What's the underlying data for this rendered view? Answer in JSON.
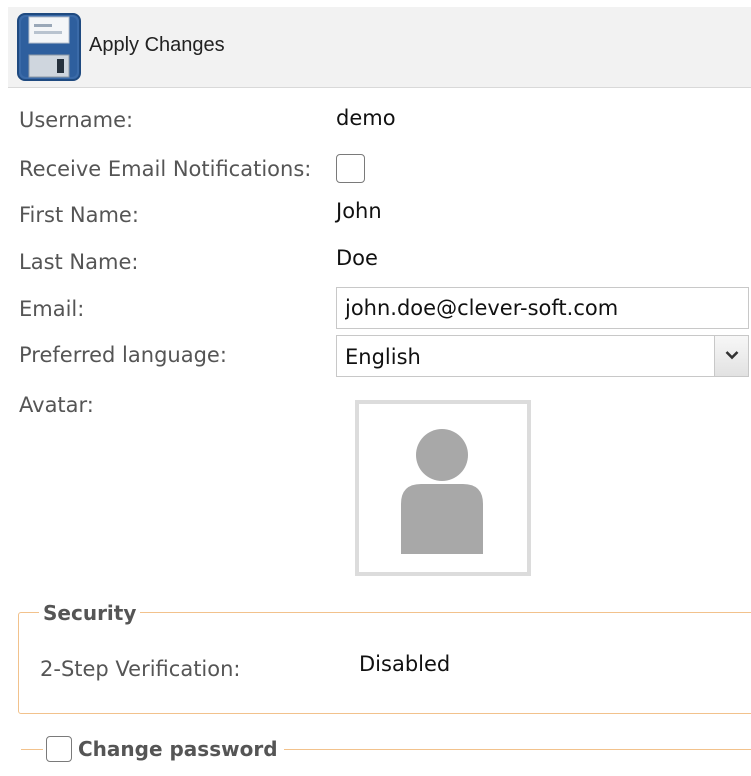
{
  "toolbar": {
    "apply_label": "Apply Changes",
    "save_icon": "floppy-disk-icon"
  },
  "form": {
    "username": {
      "label": "Username:",
      "value": "demo"
    },
    "email_notifications": {
      "label": "Receive Email Notifications:",
      "checked": false
    },
    "first_name": {
      "label": "First Name:",
      "value": "John"
    },
    "last_name": {
      "label": "Last Name:",
      "value": "Doe"
    },
    "email": {
      "label": "Email:",
      "value": "john.doe@clever-soft.com"
    },
    "preferred_language": {
      "label": "Preferred language:",
      "selected": "English",
      "arrow_icon": "chevron-down-icon"
    },
    "avatar": {
      "label": "Avatar:",
      "icon": "user-silhouette-icon"
    }
  },
  "security": {
    "legend": "Security",
    "two_step": {
      "label": "2-Step Verification:",
      "value": "Disabled"
    }
  },
  "change_password": {
    "legend": "Change password",
    "checked": false
  },
  "colors": {
    "toolbar_bg": "#f2f2f2",
    "label_text": "#555555",
    "fieldset_border": "#f2c28c",
    "floppy_blue": "#2e5f9e"
  }
}
